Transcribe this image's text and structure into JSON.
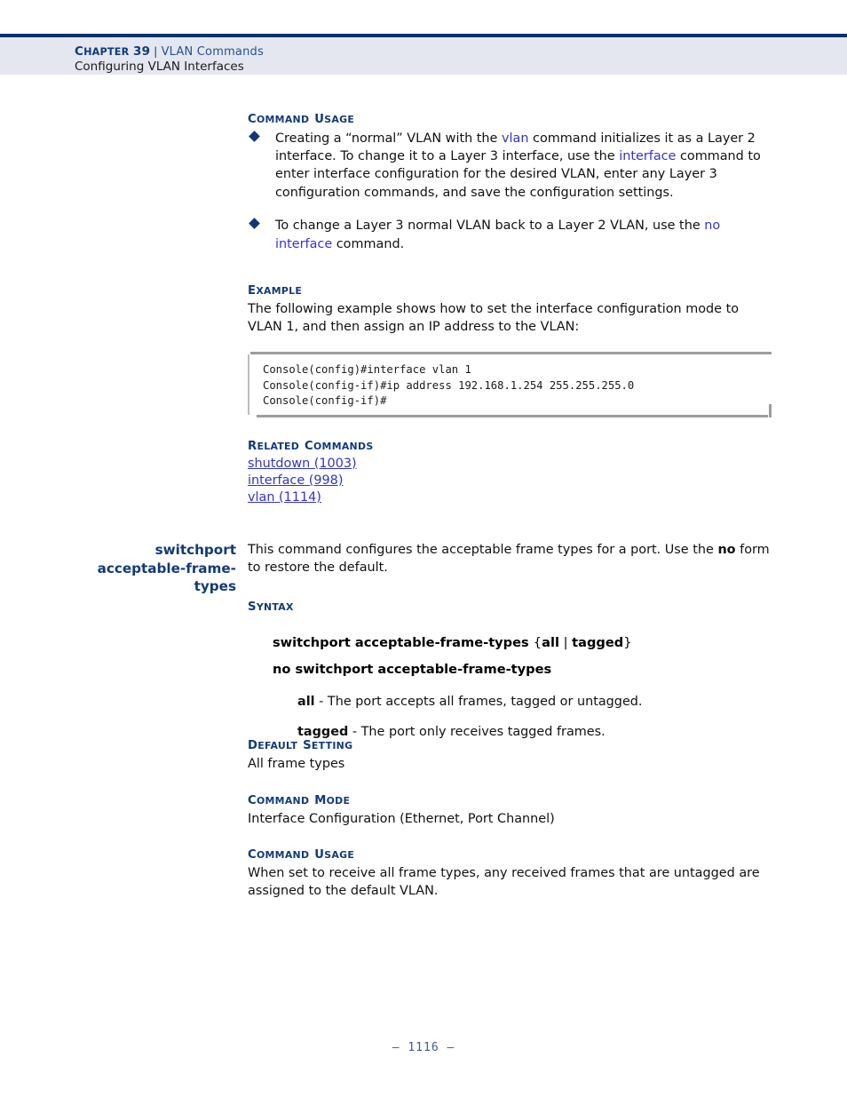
{
  "header": {
    "chapter_cap": "C",
    "chapter_rest": "HAPTER",
    "chapter_number": "39",
    "separator": "|",
    "topic": "VLAN Commands",
    "subtitle": "Configuring VLAN Interfaces"
  },
  "sections": {
    "command_usage_1": {
      "head_cap_1": "C",
      "head_sc_1": "OMMAND",
      "head_cap_2": "U",
      "head_sc_2": "SAGE",
      "bullets": [
        {
          "part1": "Creating a “normal” VLAN with the ",
          "link1": "vlan",
          "part2": " command initializes it as a Layer 2 interface. To change it to a Layer 3 interface, use the ",
          "link2": "interface",
          "part3": " command to enter interface configuration for the desired VLAN, enter any Layer 3 configuration commands, and save the configuration settings."
        },
        {
          "part1": "To change a Layer 3 normal VLAN back to a Layer 2 VLAN, use the ",
          "link1": "no interface",
          "part2": " command.",
          "link2": "",
          "part3": ""
        }
      ]
    },
    "example": {
      "head_cap_1": "E",
      "head_sc_1": "XAMPLE",
      "text": "The following example shows how to set the interface configuration mode to VLAN 1, and then assign an IP address to the VLAN:",
      "console": "Console(config)#interface vlan 1\nConsole(config-if)#ip address 192.168.1.254 255.255.255.0\nConsole(config-if)#"
    },
    "related_commands": {
      "head_cap_1": "R",
      "head_sc_1": "ELATED",
      "head_cap_2": "C",
      "head_sc_2": "OMMANDS",
      "links": [
        "shutdown (1003)",
        "interface (998)",
        "vlan (1114)"
      ]
    },
    "switchport": {
      "margin_title_line1": "switchport",
      "margin_title_line2": "acceptable-frame-",
      "margin_title_line3": "types",
      "intro_part1": "This command configures the acceptable frame types for a port. Use the ",
      "intro_bold": "no",
      "intro_part2": " form to restore the default.",
      "syntax": {
        "head_cap_1": "S",
        "head_sc_1": "YNTAX",
        "line1_bold_a": "switchport acceptable-frame-types ",
        "line1_brace_open": "{",
        "line1_bold_b": "all",
        "line1_pipe": " | ",
        "line1_bold_c": "tagged",
        "line1_brace_close": "}",
        "line2": "no switchport acceptable-frame-types",
        "params": [
          {
            "name": "all",
            "desc": " - The port accepts all frames, tagged or untagged."
          },
          {
            "name": "tagged",
            "desc": " - The port only receives tagged frames."
          }
        ]
      },
      "default_setting": {
        "head_cap_1": "D",
        "head_sc_1": "EFAULT",
        "head_cap_2": "S",
        "head_sc_2": "ETTING",
        "text": "All frame types"
      },
      "command_mode": {
        "head_cap_1": "C",
        "head_sc_1": "OMMAND",
        "head_cap_2": "M",
        "head_sc_2": "ODE",
        "text": "Interface Configuration (Ethernet, Port Channel)"
      },
      "command_usage": {
        "head_cap_1": "C",
        "head_sc_1": "OMMAND",
        "head_cap_2": "U",
        "head_sc_2": "SAGE",
        "text": "When set to receive all frame types, any received frames that are untagged are assigned to the default VLAN."
      }
    }
  },
  "footer": {
    "page_number": "–  1116  –"
  }
}
